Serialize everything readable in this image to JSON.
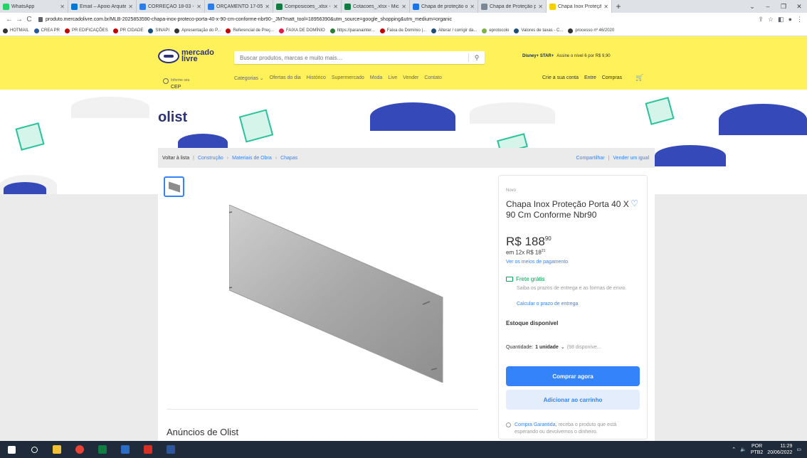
{
  "browser": {
    "tabs": [
      {
        "title": "WhatsApp",
        "color": "#25d366",
        "active": false
      },
      {
        "title": "Email – Apoio Arquite",
        "color": "#0078d4",
        "active": false
      },
      {
        "title": "CORREÇÃO 18-03 - C",
        "color": "#2b7de9",
        "active": false
      },
      {
        "title": "ORÇAMENTO 17-05-2",
        "color": "#2b7de9",
        "active": false
      },
      {
        "title": "Composicoes_.xlsx - M",
        "color": "#107c41",
        "active": false
      },
      {
        "title": "Cotacoes_.xlsx - Micr",
        "color": "#107c41",
        "active": false
      },
      {
        "title": "Chapa de proteção ou",
        "color": "#1a73e8",
        "active": false
      },
      {
        "title": "Chapa de Proteção pa",
        "color": "#7b8794",
        "active": false
      },
      {
        "title": "Chapa Inox Proteção",
        "color": "#f6d100",
        "active": true
      }
    ],
    "url": "produto.mercadolivre.com.br/MLB-2025853590-chapa-inox-proteco-porta-40-x-90-cm-conforme-nbr90-_JM?matt_tool=18956390&utm_source=google_shopping&utm_medium=organic",
    "bookmarks": [
      {
        "label": "HOTMAIL",
        "color": "#333333"
      },
      {
        "label": "CREA PR",
        "color": "#2b579a"
      },
      {
        "label": "PR EDIFICAÇÕES",
        "color": "#c00000"
      },
      {
        "label": "PR CIDADE",
        "color": "#c00000"
      },
      {
        "label": "SINAPI",
        "color": "#1f4e79"
      },
      {
        "label": "Apresentação do P...",
        "color": "#333333"
      },
      {
        "label": "Referencial de Preç...",
        "color": "#c00000"
      },
      {
        "label": "FAIXA DE DOMÍNIO",
        "color": "#e11d48"
      },
      {
        "label": "https://paranainter...",
        "color": "#2e7d32"
      },
      {
        "label": "Faixa de Domínio |...",
        "color": "#c00000"
      },
      {
        "label": "Alterar / corrigir da...",
        "color": "#1f4e79"
      },
      {
        "label": "eprotocolo",
        "color": "#7cb342"
      },
      {
        "label": "Valores de taxas - C...",
        "color": "#1f4e79"
      },
      {
        "label": "processo nº 46/2020",
        "color": "#333333"
      }
    ]
  },
  "ml": {
    "logo_line1": "mercado",
    "logo_line2": "livre",
    "search_placeholder": "Buscar produtos, marcas e muito mais…",
    "promo_brand": "Disney+ STAR+",
    "promo_text": "Assine o nível 6 por R$ 9,90",
    "cep_label": "Informe seu",
    "cep_value": "CEP",
    "categories": [
      "Categorias ⌄",
      "Ofertas do dia",
      "Histórico",
      "Supermercado",
      "Moda",
      "Live",
      "Vender",
      "Contato"
    ],
    "account": [
      "Crie a sua conta",
      "Entre",
      "Compras"
    ]
  },
  "banner": {
    "brand": "olist"
  },
  "breadcrumb": {
    "back": "Voltar à lista",
    "items": [
      "Construção",
      "Materiais de Obra",
      "Chapas"
    ],
    "share": "Compartilhar",
    "sell": "Vender um igual"
  },
  "product": {
    "condition": "Novo",
    "title": "Chapa Inox Proteção Porta 40 X 90 Cm Conforme Nbr90",
    "price_int": "R$ 188",
    "price_cents": "90",
    "install_text": "em 12x R$ 18",
    "install_cents": "21",
    "pay_link": "Ver os meios de pagamento",
    "shipping": "Frete grátis",
    "shipping_desc": "Saiba os prazos de entrega e as formas de envio.",
    "shipping_link": "Calcular o prazo de entrega",
    "stock": "Estoque disponível",
    "qty_label": "Quantidade:",
    "qty_value": "1 unidade",
    "qty_avail": "(98 disponíve...",
    "buy_button": "Comprar agora",
    "cart_button": "Adicionar ao carrinho",
    "guarantee_link": "Compra Garantida,",
    "guarantee_text": "receba o produto que está esperando ou devolvemos o dinheiro."
  },
  "seller_ads_title": "Anúncios de Olist",
  "taskbar": {
    "lang": "POR",
    "layout": "PTB2",
    "time": "11:29",
    "date": "20/06/2022"
  }
}
